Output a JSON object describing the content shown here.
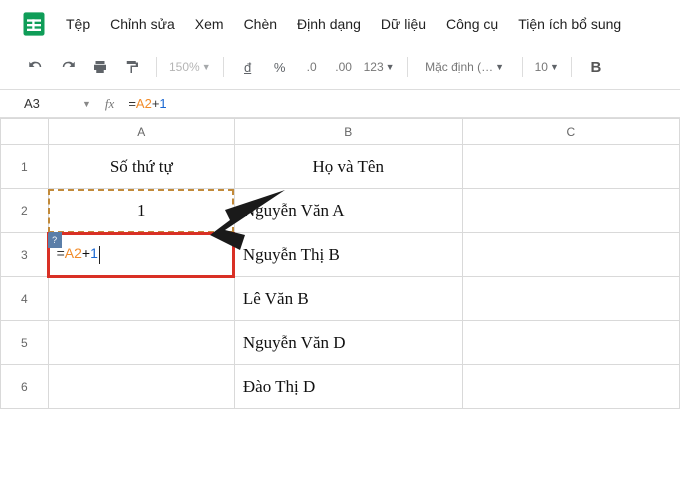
{
  "menu": {
    "file": "Tệp",
    "edit": "Chỉnh sửa",
    "view": "Xem",
    "insert": "Chèn",
    "format": "Định dạng",
    "data": "Dữ liệu",
    "tools": "Công cụ",
    "addons": "Tiện ích bổ sung"
  },
  "toolbar": {
    "zoom": "150%",
    "currency": "đ",
    "percent": "%",
    "dec_less": ".0",
    "dec_more": ".00",
    "num_format": "123",
    "font": "Mặc định (…",
    "font_size": "10",
    "bold": "B"
  },
  "namebox": {
    "value": "A3"
  },
  "formula_bar": {
    "eq": "=",
    "ref": "A2",
    "plus": "+",
    "num": "1"
  },
  "columns": {
    "a": "A",
    "b": "B",
    "c": "C"
  },
  "rows": {
    "r1": "1",
    "r2": "2",
    "r3": "3",
    "r4": "4",
    "r5": "5",
    "r6": "6"
  },
  "cells": {
    "a1": "Số thứ tự",
    "b1": "Họ và Tên",
    "a2": "1",
    "b2": "Nguyễn Văn A",
    "a3_eq": "=",
    "a3_ref": "A2",
    "a3_plus": "+",
    "a3_num": "1",
    "b3": "Nguyễn Thị B",
    "b4": "Lê Văn B",
    "b5": "Nguyễn Văn D",
    "b6": "Đào Thị D"
  },
  "hint": "?"
}
